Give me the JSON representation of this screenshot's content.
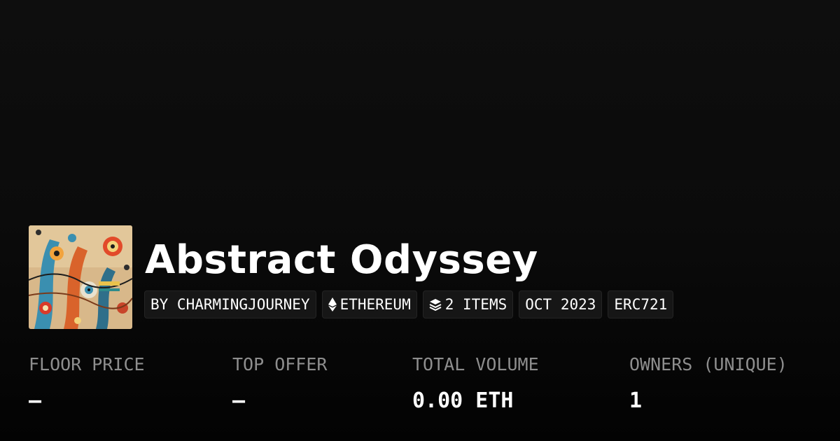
{
  "collection": {
    "title": "Abstract Odyssey",
    "thumbnail_icon": "abstract-artwork-thumbnail"
  },
  "tags": [
    {
      "label": "BY CHARMINGJOURNEY",
      "icon": null
    },
    {
      "label": "ETHEREUM",
      "icon": "ethereum-icon"
    },
    {
      "label": "2 ITEMS",
      "icon": "layers-icon"
    },
    {
      "label": "OCT 2023",
      "icon": null
    },
    {
      "label": "ERC721",
      "icon": null
    }
  ],
  "stats": {
    "floor_price": {
      "label": "FLOOR PRICE",
      "value": "–"
    },
    "top_offer": {
      "label": "TOP OFFER",
      "value": "–"
    },
    "total_volume": {
      "label": "TOTAL VOLUME",
      "value": "0.00 ETH"
    },
    "owners": {
      "label": "OWNERS (UNIQUE)",
      "value": "1"
    }
  },
  "colors": {
    "background": "#0b0b0b",
    "tag_background": "#161616",
    "label_gray": "#8e8e8e",
    "text": "#ffffff"
  }
}
